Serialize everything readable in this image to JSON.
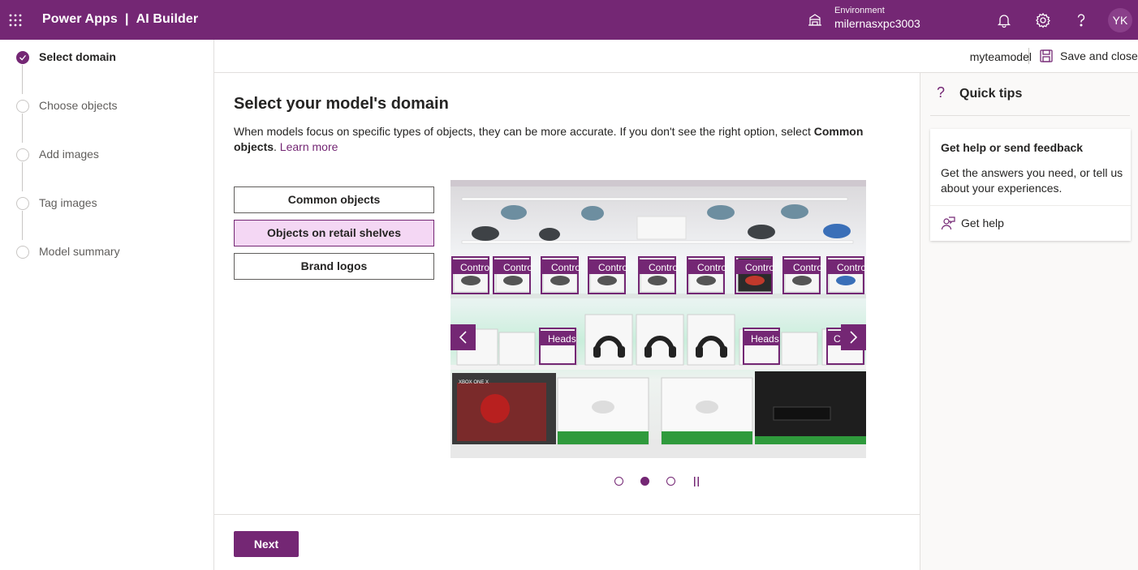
{
  "header": {
    "app_name": "Power Apps",
    "separator": "|",
    "section": "AI Builder",
    "environment_label": "Environment",
    "environment_value": "milernasxpc3003",
    "avatar_initials": "YK",
    "brand_color": "#742774"
  },
  "steps": [
    {
      "label": "Select domain",
      "state": "done"
    },
    {
      "label": "Choose objects",
      "state": "todo"
    },
    {
      "label": "Add images",
      "state": "todo"
    },
    {
      "label": "Tag images",
      "state": "todo"
    },
    {
      "label": "Model summary",
      "state": "todo"
    }
  ],
  "commandbar": {
    "model_name": "myteamodel",
    "save_label": "Save and close"
  },
  "main": {
    "title": "Select your model's domain",
    "description_start": "When models focus on specific types of objects, they can be more accurate. If you don't see the right option, select ",
    "description_bold": "Common objects",
    "description_end": ". ",
    "learn_more": "Learn more",
    "domains": [
      {
        "label": "Common objects",
        "selected": false
      },
      {
        "label": "Objects on retail shelves",
        "selected": true
      },
      {
        "label": "Brand logos",
        "selected": false
      }
    ],
    "carousel": {
      "tag_controller": "Contro",
      "tag_headset": "Heads",
      "tag_partial": "C",
      "box_label": "XBOX ONE X",
      "active_slide": 2,
      "slide_count": 3
    },
    "next_label": "Next"
  },
  "quick_tips": {
    "title": "Quick tips",
    "card_title": "Get help or send feedback",
    "card_body": "Get the answers you need, or tell us about your experiences.",
    "help_link": "Get help"
  }
}
